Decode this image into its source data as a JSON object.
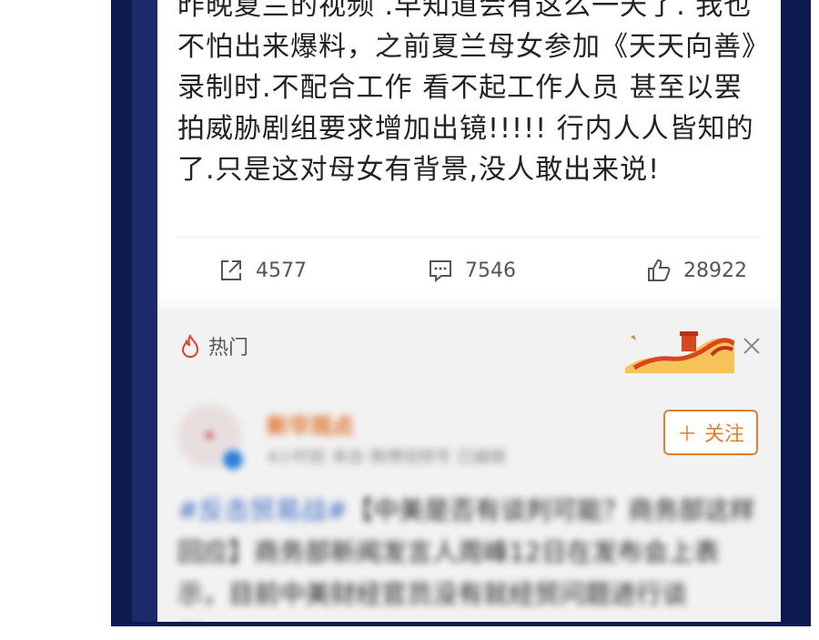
{
  "post": {
    "text": "昨晚夏兰的视频 .早知道会有这么一天了. 我也不怕出来爆料，之前夏兰母女参加《天天向善》录制时.不配合工作 看不起工作人员 甚至以罢拍威胁剧组要求增加出镜!!!!! 行内人人皆知的了.只是这对母女有背景,没人敢出来说!",
    "shares": "4577",
    "comments": "7546",
    "likes": "28922"
  },
  "hot_section": {
    "label": "热门",
    "follow_label": "关注",
    "card": {
      "account_name": "新华观点",
      "meta": "4小时前  来自 微博视频号  已编辑",
      "hashtag": "#反击贸易战#",
      "text": "【中美是否有谈判可能？商务部这样回应】商务部新闻发言人周峰12日在发布会上表示，目前中美财经官员没有就经贸问题进行谈判……"
    }
  },
  "colors": {
    "accent_orange": "#e0802f",
    "link_blue": "#3a6bc6",
    "frame_navy": "#0d1a4f"
  },
  "icons": [
    "share-icon",
    "comment-icon",
    "like-icon",
    "fire-icon",
    "close-icon",
    "verified-icon"
  ]
}
